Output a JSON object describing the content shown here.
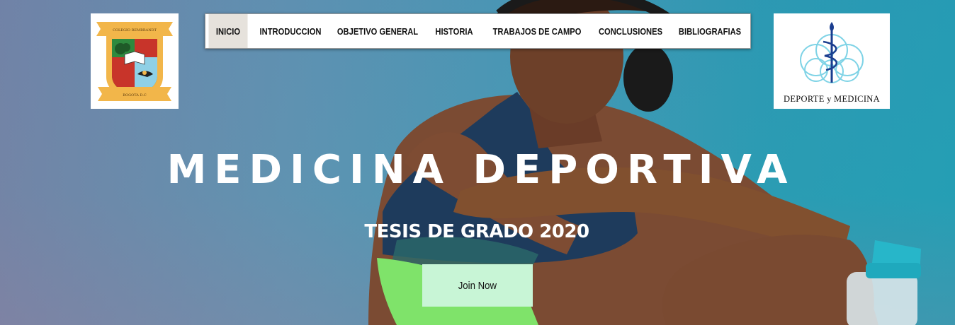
{
  "header": {
    "nav_items": [
      {
        "label": "INICIO",
        "active": true
      },
      {
        "label": "INTRODUCCION"
      },
      {
        "label": "OBJETIVO GENERAL"
      },
      {
        "label": "HISTORIA"
      },
      {
        "label": "TRABAJOS DE CAMPO"
      },
      {
        "label": "CONCLUSIONES"
      },
      {
        "label": "BIBLIOGRAFIAS"
      }
    ],
    "logo_left": {
      "banner_top": "COLEGIO REMBRANDT",
      "banner_bottom": "BOGOTA D.C"
    },
    "logo_right": {
      "caption": "DEPORTE y MEDICINA"
    }
  },
  "hero": {
    "title": "MEDICINA DEPORTIVA",
    "subtitle": "TESIS DE GRADO 2020",
    "cta_label": "Join Now"
  },
  "colors": {
    "cta_background": "#c8f5d6",
    "nav_active_background": "#e6e2dc",
    "logo_shield_green": "#2e8a3e",
    "logo_shield_red": "#c8342a",
    "logo_ribbon_gold": "#f2b64a",
    "logo_symbol_blue": "#1a3d8f",
    "logo_rings_cyan": "#7fd3e6"
  }
}
